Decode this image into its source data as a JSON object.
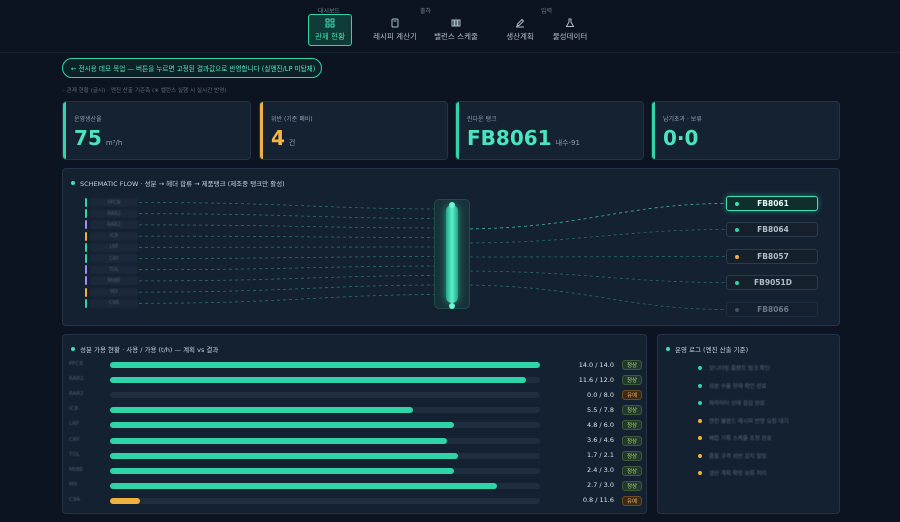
{
  "nav": {
    "groups": [
      "대시보드",
      "출하",
      "입력"
    ],
    "items": [
      {
        "label": "관제 현황",
        "icon": "grid-icon",
        "active": true
      },
      {
        "label": "레시피 계산기",
        "icon": "calculator-icon",
        "active": false
      },
      {
        "label": "밸런스 스케줄",
        "icon": "tanks-icon",
        "active": false
      },
      {
        "label": "생산계획",
        "icon": "pencil-icon",
        "active": false
      },
      {
        "label": "물성데이터",
        "icon": "flask-icon",
        "active": false
      }
    ]
  },
  "banner": "← 전시용 데모 목업 — 버튼을 누르면 고정된 결과값으로 반영합니다 (실엔진/LP 미탑재)",
  "subnote": "· 관제 현황 (글시) · 엔진 산출 기준축 (※ 밸런스 실행 시 실시간 반영)",
  "cards": [
    {
      "label": "운영생산율",
      "value": "75",
      "unit": "m³/h",
      "accent": "#2fd4a8",
      "color": "#4ce3c0"
    },
    {
      "label": "위반 (기준 폐비)",
      "value": "4",
      "unit": "건",
      "accent": "#f0b040",
      "color": "#f5b545"
    },
    {
      "label": "린다운 탱크",
      "value": "FB8061",
      "unit": "내수-91",
      "accent": "#2fd4a8",
      "color": "#4ce3c0"
    },
    {
      "label": "납기초과 · 보류",
      "value": "0·0",
      "unit": "",
      "accent": "#2fd4a8",
      "color": "#4ce3c0"
    }
  ],
  "schematic": {
    "title": "SCHEMATIC FLOW · 성분 → 헤더 합류 → 제품탱크 (제조중 탱크만 활성)",
    "sources": [
      {
        "name": "PFCB",
        "color": "#2fd4a8"
      },
      {
        "name": "RAR2",
        "color": "#2fd4a8"
      },
      {
        "name": "RAR2",
        "color": "#a78bfa"
      },
      {
        "name": "ICB",
        "color": "#f0b040"
      },
      {
        "name": "LRF",
        "color": "#2fd4a8"
      },
      {
        "name": "CRY",
        "color": "#2fd4a8"
      },
      {
        "name": "TOL",
        "color": "#a78bfa"
      },
      {
        "name": "MtBE",
        "color": "#a78bfa"
      },
      {
        "name": "MX",
        "color": "#f0b040"
      },
      {
        "name": "C9A",
        "color": "#2fd4a8"
      }
    ],
    "tanks": [
      {
        "name": "FB8061",
        "active": true,
        "led": "#3fe0b3"
      },
      {
        "name": "FB8064",
        "active": false,
        "led": "#2fd4a8"
      },
      {
        "name": "FB8057",
        "active": false,
        "led": "#f0b040"
      },
      {
        "name": "FB9051D",
        "active": false,
        "led": "#2fd4a8"
      },
      {
        "name": "FB8066",
        "active": false,
        "led": "#6b7a88"
      }
    ]
  },
  "usage": {
    "title": "성분 가용 현황 · 사용 / 가용 (t/h) — 계획 vs 결과",
    "rows": [
      {
        "name": "PFCB",
        "used": 14.0,
        "avail": 14.0,
        "ratio": "14.0 / 14.0",
        "status": "정상",
        "color": "#2fd4a8"
      },
      {
        "name": "RAR2",
        "used": 11.6,
        "avail": 12.0,
        "ratio": "11.6 / 12.0",
        "status": "정상",
        "color": "#2fd4a8"
      },
      {
        "name": "RAR2",
        "used": 0.0,
        "avail": 8.0,
        "ratio": "0.0 / 8.0",
        "status": "유예",
        "color": "#2fd4a8"
      },
      {
        "name": "ICB",
        "used": 5.5,
        "avail": 7.8,
        "ratio": "5.5 / 7.8",
        "status": "정상",
        "color": "#2fd4a8"
      },
      {
        "name": "LRF",
        "used": 4.8,
        "avail": 6.0,
        "ratio": "4.8 / 6.0",
        "status": "정상",
        "color": "#2fd4a8"
      },
      {
        "name": "CRY",
        "used": 3.6,
        "avail": 4.6,
        "ratio": "3.6 / 4.6",
        "status": "정상",
        "color": "#2fd4a8"
      },
      {
        "name": "TOL",
        "used": 1.7,
        "avail": 2.1,
        "ratio": "1.7 / 2.1",
        "status": "정상",
        "color": "#2fd4a8"
      },
      {
        "name": "MtBE",
        "used": 2.4,
        "avail": 3.0,
        "ratio": "2.4 / 3.0",
        "status": "정상",
        "color": "#2fd4a8"
      },
      {
        "name": "MX",
        "used": 2.7,
        "avail": 3.0,
        "ratio": "2.7 / 3.0",
        "status": "정상",
        "color": "#2fd4a8"
      },
      {
        "name": "C9A",
        "used": 0.8,
        "avail": 11.6,
        "ratio": "0.8 / 11.6",
        "status": "유예",
        "color": "#f0b040"
      }
    ]
  },
  "log": {
    "title": "운영 로그 (엔진 산출 기준)",
    "entries": [
      {
        "text": "모니터링 플랜트 링크 확인",
        "color": "#2fd4a8"
      },
      {
        "text": "성분 수율 현재 확인 완료",
        "color": "#2fd4a8"
      },
      {
        "text": "파라미터 상태 점검 완료",
        "color": "#2fd4a8"
      },
      {
        "text": "엔진 블렌드 레시피 반영 요청 대기",
        "color": "#f0b040"
      },
      {
        "text": "배합 기록 스케줄 조정 완료",
        "color": "#f0b040"
      },
      {
        "text": "품질 규격 위반 감지 알림",
        "color": "#f0b040"
      },
      {
        "text": "생산 계획 확정 보류 처리",
        "color": "#f0b040"
      }
    ]
  }
}
